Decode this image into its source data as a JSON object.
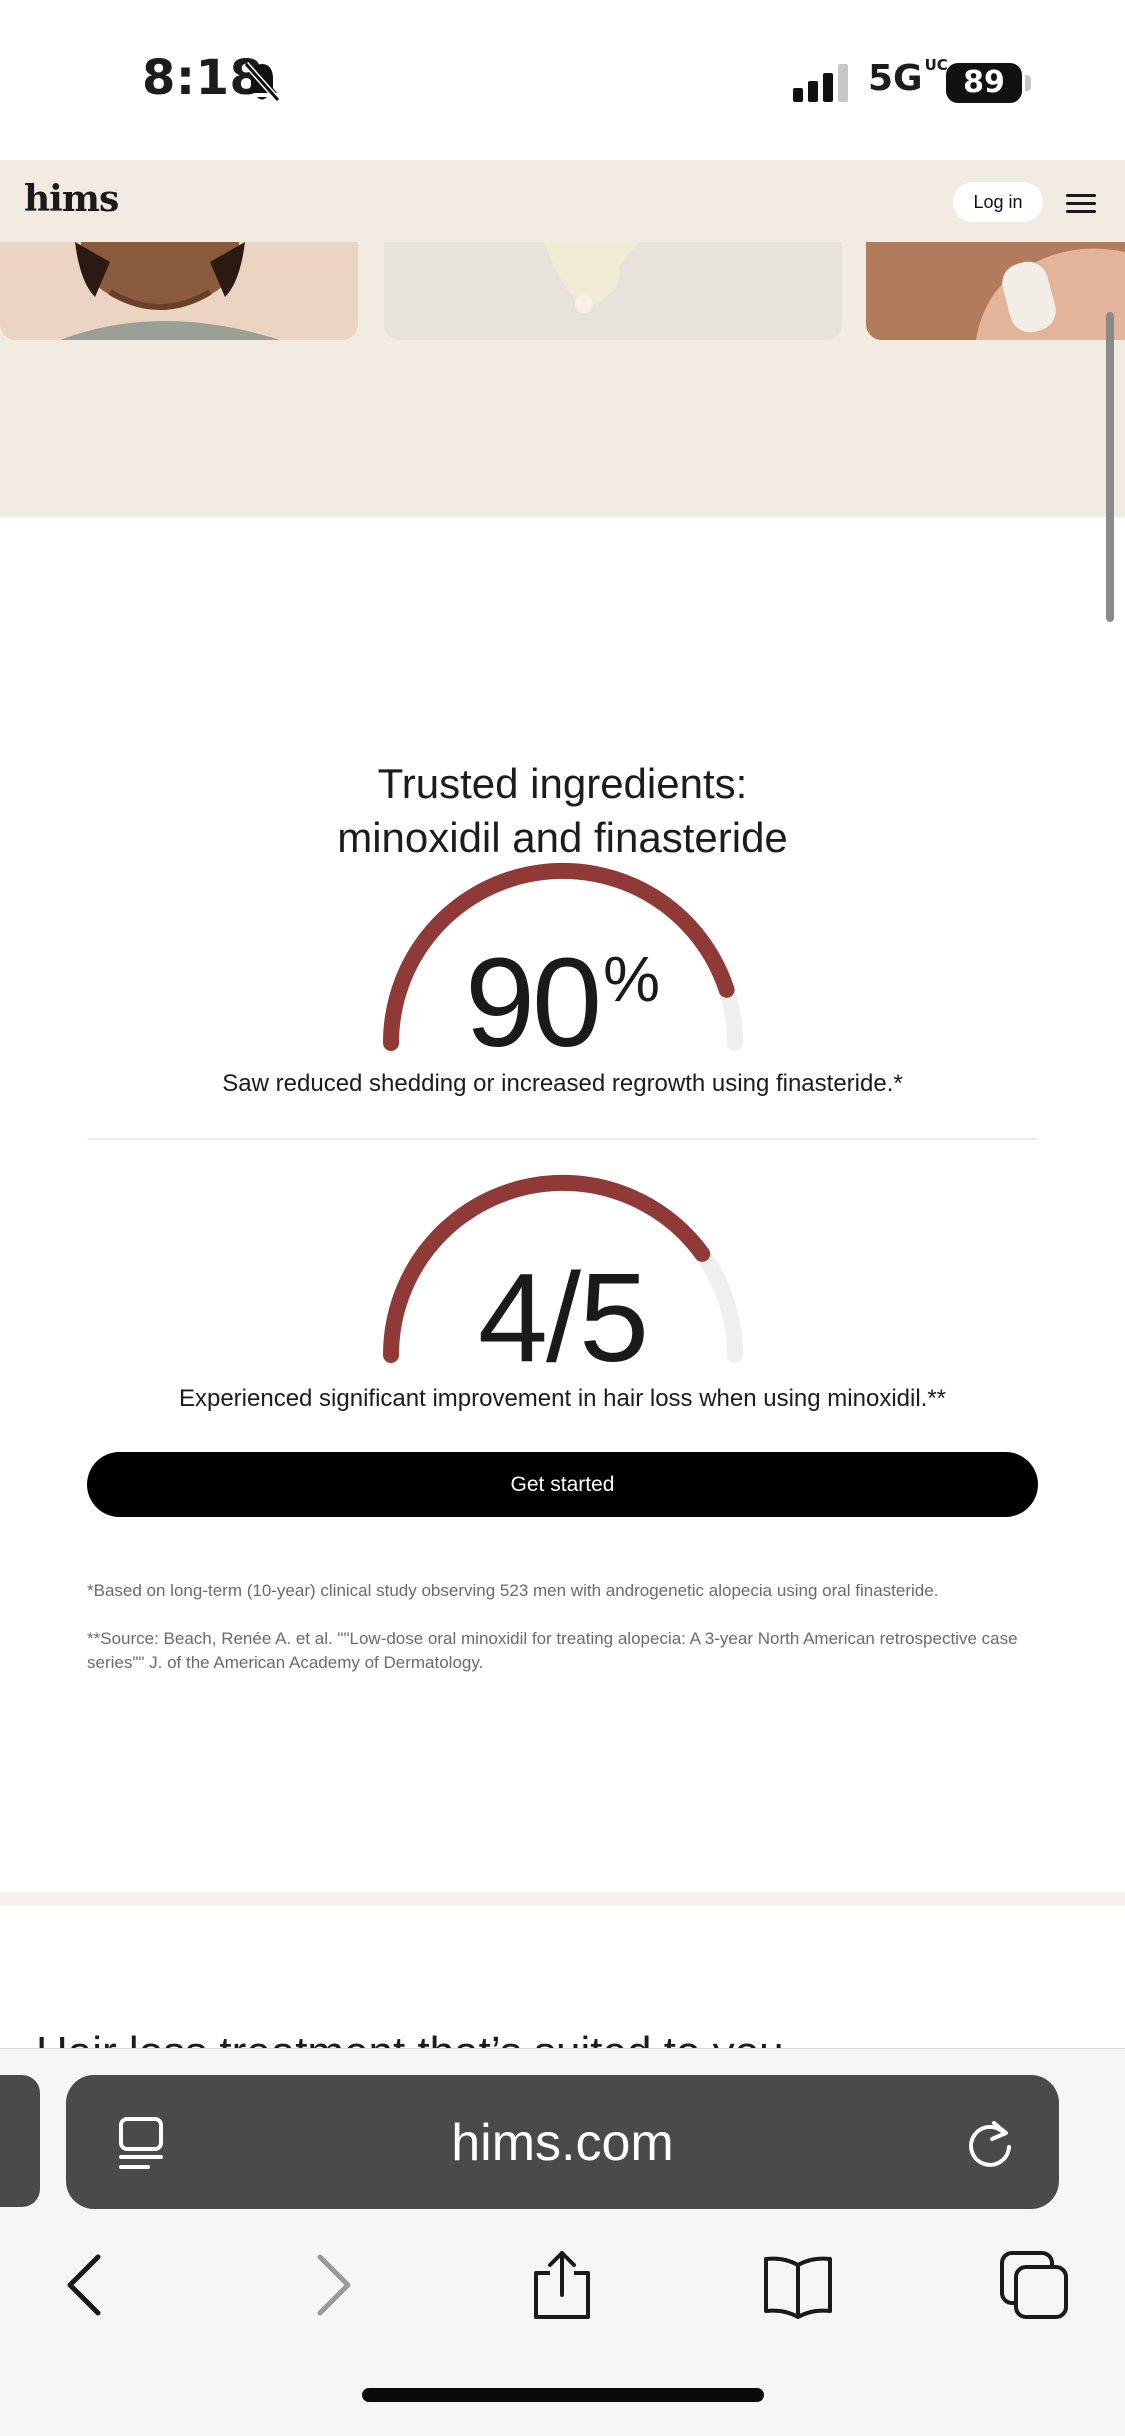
{
  "status_bar": {
    "time": "8:18",
    "network": "5G",
    "network_sub": "UC",
    "battery": "89",
    "icons": [
      "bell-slash-icon",
      "cellular-signal-icon",
      "battery-icon"
    ]
  },
  "header": {
    "logo": "hims",
    "login_label": "Log in",
    "menu_icon": "hamburger-icon"
  },
  "main": {
    "title_line1": "Trusted ingredients:",
    "title_line2": "minoxidil and finasteride",
    "stats": [
      {
        "value": "90",
        "suffix": "%",
        "gauge_fill": 0.9,
        "description": "Saw reduced shedding or increased regrowth using finasteride.*"
      },
      {
        "value": "4/5",
        "suffix": "",
        "gauge_fill": 0.8,
        "description": "Experienced significant improvement in hair loss when using minoxidil.**"
      }
    ],
    "cta_label": "Get started",
    "footnotes": [
      "*Based on long-term (10-year) clinical study observing 523 men with androgenetic alopecia using oral finasteride.",
      "**Source: Beach, Renée A. et al. \"\"Low-dose oral minoxidil for treating alopecia: A 3-year North American retrospective case series\"\" J. of the American Academy of Dermatology."
    ],
    "next_section_title": "Hair loss treatment that’s suited to you"
  },
  "colors": {
    "gauge_fill": "#8f3a36",
    "gauge_track": "#efefef",
    "header_bg": "#f2ebe2",
    "cta_bg": "#000000"
  },
  "browser": {
    "url": "hims.com",
    "icons": [
      "reader-mode-icon",
      "reload-icon",
      "back-icon",
      "forward-icon",
      "share-icon",
      "bookmarks-icon",
      "tabs-icon"
    ]
  }
}
